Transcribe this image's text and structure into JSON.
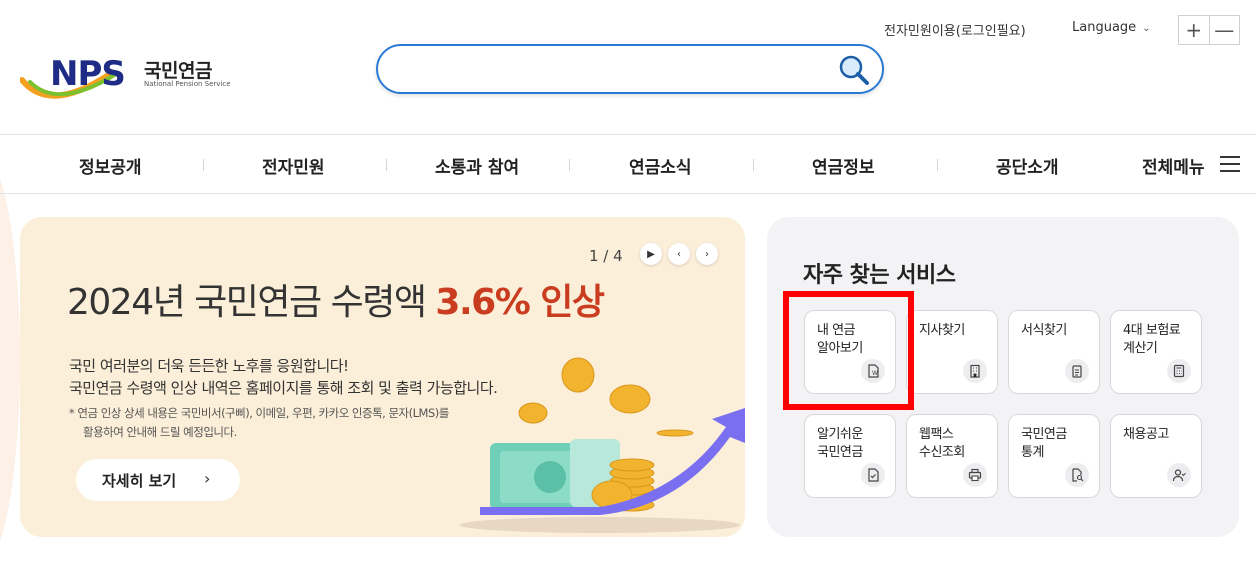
{
  "header": {
    "logo_text": "NPS",
    "logo_korean": "국민연금",
    "logo_english": "National Pension Service",
    "util_link": "전자민원이용(로그인필요)",
    "language_label": "Language",
    "zoom_in": "+",
    "zoom_out": "—",
    "search_value": "",
    "search_placeholder": ""
  },
  "nav": {
    "items": [
      "정보공개",
      "전자민원",
      "소통과 참여",
      "연금소식",
      "연금정보",
      "공단소개"
    ],
    "all_menu": "전체메뉴"
  },
  "banner": {
    "pager": "1 / 4",
    "title_prefix": "2024년 국민연금 수령액 ",
    "title_highlight": "3.6% 인상",
    "desc_line1": "국민 여러분의 더욱 든든한 노후를 응원합니다!",
    "desc_line2": "국민연금 수령액 인상 내역은 홈페이지를 통해 조회 및 출력 가능합니다.",
    "note_line1": "* 연금 인상 상세 내용은 국민비서(구삐), 이메일, 우편, 카카오 인증톡, 문자(LMS)를",
    "note_line2": "활용하여 안내해 드릴 예정입니다.",
    "more_label": "자세히 보기",
    "colors": {
      "background": "#fcefd9",
      "highlight": "#c93c1f"
    }
  },
  "services": {
    "title": "자주 찾는 서비스",
    "items": [
      {
        "line1": "내 연금",
        "line2": "알아보기",
        "icon": "document-won-icon"
      },
      {
        "line1": "지사찾기",
        "line2": "",
        "icon": "building-icon"
      },
      {
        "line1": "서식찾기",
        "line2": "",
        "icon": "clipboard-icon"
      },
      {
        "line1": "4대 보험료",
        "line2": "계산기",
        "icon": "calculator-icon"
      },
      {
        "line1": "알기쉬운",
        "line2": "국민연금",
        "icon": "document-check-icon"
      },
      {
        "line1": "웹팩스",
        "line2": "수신조회",
        "icon": "printer-icon"
      },
      {
        "line1": "국민연금",
        "line2": "통계",
        "icon": "document-search-icon"
      },
      {
        "line1": "채용공고",
        "line2": "",
        "icon": "person-icon"
      }
    ],
    "highlight_color": "#ff0000"
  }
}
